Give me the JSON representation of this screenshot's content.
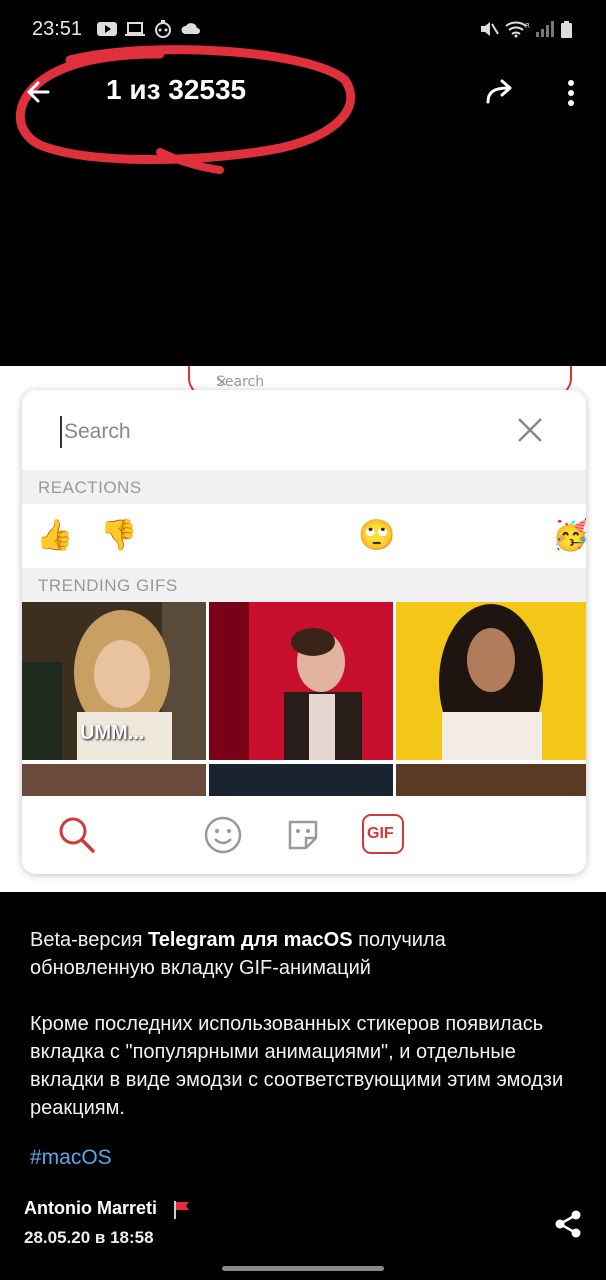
{
  "status_bar": {
    "time": "23:51",
    "icons": [
      "youtube-icon",
      "laptop-icon",
      "robot-icon",
      "cloud-icon",
      "mute-icon",
      "wifi-icon",
      "signal-icon",
      "battery-icon"
    ]
  },
  "header": {
    "counter": "1 из 32535",
    "back_icon": "back-arrow-icon",
    "forward_icon": "forward-icon",
    "more_icon": "more-vert-icon",
    "annotation_color": "#e0303c"
  },
  "screenshot": {
    "bg_search_text": "Search",
    "search": {
      "placeholder": "Search",
      "value": ""
    },
    "sections": {
      "reactions": "REACTIONS",
      "trending": "TRENDING GIFS"
    },
    "reactions": [
      "👍",
      "👎",
      "😍",
      "😂",
      "😮",
      "🙄",
      "😥",
      "😡",
      "🥳"
    ],
    "gif_caption": "UMM...",
    "bottom_tabs": [
      "search-tab",
      "emoji-tab",
      "sticker-tab",
      "gif-tab"
    ],
    "gif_label": "GIF",
    "accent": "#d23a3a"
  },
  "caption": {
    "p1_a": "Beta-версия ",
    "p1_b": "Telegram для macOS",
    "p1_c": " получила обновленную вкладку GIF-анимаций",
    "p2": "Кроме последних использованных стикеров появилась вкладка с \"популярными анимациями\", и отдельные вкладки в виде эмодзи с соответствующими этим эмодзи реакциям.",
    "hashtag": "#macOS"
  },
  "footer": {
    "author": "Antonio Marreti",
    "date": "28.05.20 в 18:58"
  }
}
